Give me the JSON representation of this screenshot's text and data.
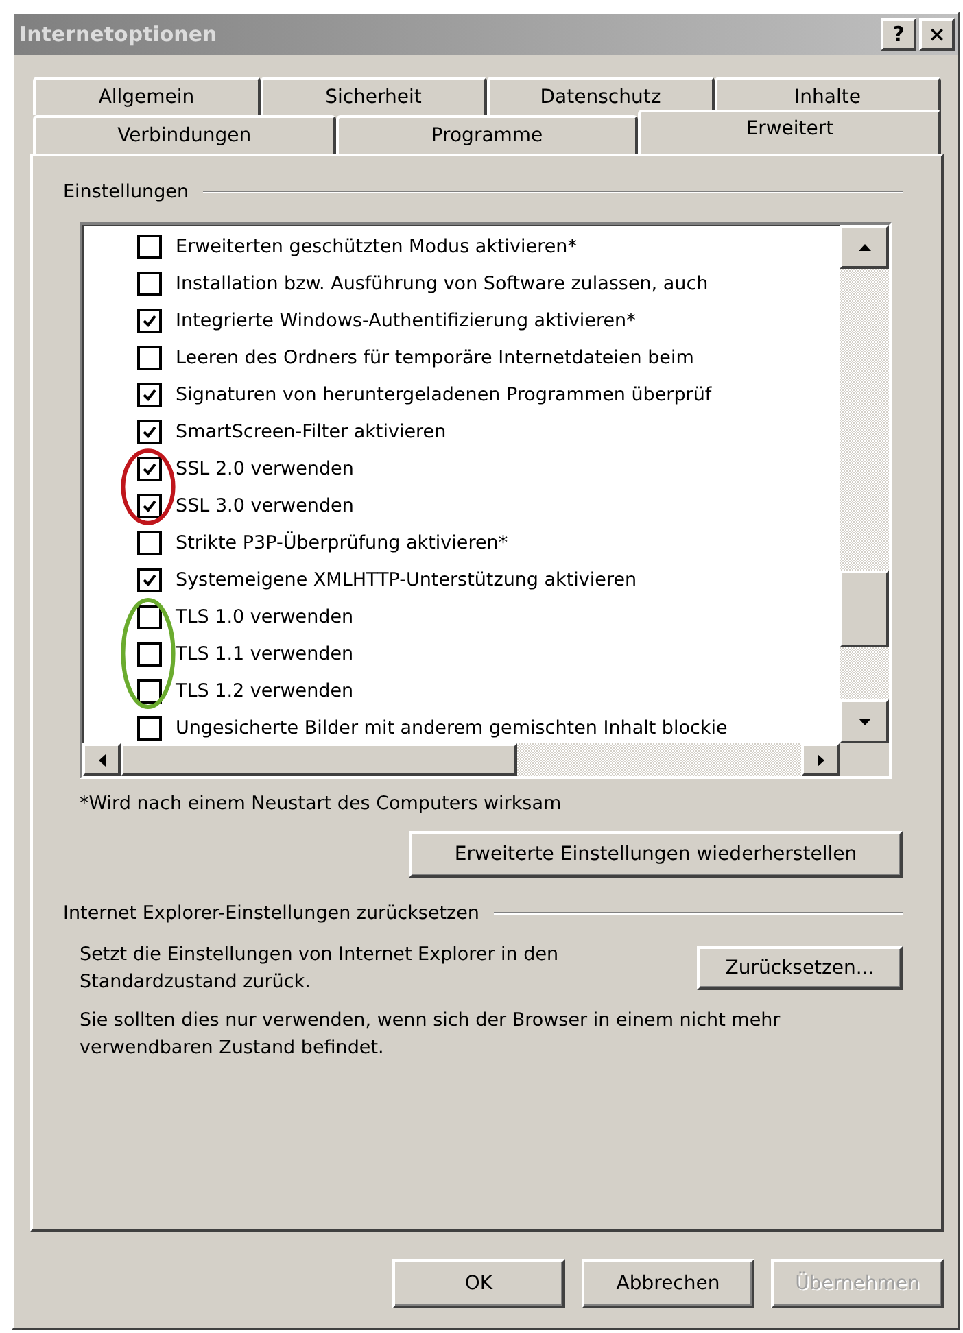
{
  "window": {
    "title": "Internetoptionen",
    "help_button": "?",
    "close_button": "×"
  },
  "tab_rows": [
    {
      "tabs": [
        {
          "label": "Allgemein",
          "selected": false
        },
        {
          "label": "Sicherheit",
          "selected": false
        },
        {
          "label": "Datenschutz",
          "selected": false
        },
        {
          "label": "Inhalte",
          "selected": false
        }
      ]
    },
    {
      "tabs": [
        {
          "label": "Verbindungen",
          "selected": false
        },
        {
          "label": "Programme",
          "selected": false
        },
        {
          "label": "Erweitert",
          "selected": true
        }
      ]
    }
  ],
  "settings": {
    "label": "Einstellungen",
    "items": [
      {
        "label": "Erweiterten geschützten Modus aktivieren*",
        "checked": false
      },
      {
        "label": "Installation bzw. Ausführung von Software zulassen, auch",
        "checked": false
      },
      {
        "label": "Integrierte Windows-Authentifizierung aktivieren*",
        "checked": true
      },
      {
        "label": "Leeren des Ordners für temporäre Internetdateien beim",
        "checked": false
      },
      {
        "label": "Signaturen von heruntergeladenen Programmen überprüf",
        "checked": true
      },
      {
        "label": "SmartScreen-Filter aktivieren",
        "checked": true
      },
      {
        "label": "SSL 2.0 verwenden",
        "checked": true,
        "color": "#c0161c"
      },
      {
        "label": "SSL 3.0 verwenden",
        "checked": true,
        "color": "#c0161c"
      },
      {
        "label": "Strikte P3P-Überprüfung aktivieren*",
        "checked": false
      },
      {
        "label": "Systemeigene XMLHTTP-Unterstützung aktivieren",
        "checked": true
      },
      {
        "label": "TLS 1.0 verwenden",
        "checked": false,
        "color": "#6aab2e"
      },
      {
        "label": "TLS 1.1 verwenden",
        "checked": false,
        "color": "#6aab2e"
      },
      {
        "label": "TLS 1.2 verwenden",
        "checked": false,
        "color": "#6aab2e"
      },
      {
        "label": "Ungesicherte Bilder mit anderem gemischten Inhalt blockie",
        "checked": false
      }
    ],
    "footnote": "*Wird nach einem Neustart des Computers wirksam",
    "restore_button": "Erweiterte Einstellungen wiederherstellen"
  },
  "reset": {
    "label": "Internet Explorer-Einstellungen zurücksetzen",
    "description": "Setzt die Einstellungen von Internet Explorer in den Standardzustand zurück.",
    "button": "Zurücksetzen...",
    "note": "Sie sollten dies nur verwenden, wenn sich der Browser in einem nicht mehr verwendbaren Zustand befindet."
  },
  "buttons": [
    {
      "label": "OK",
      "disabled": false
    },
    {
      "label": "Abbrechen",
      "disabled": false
    },
    {
      "label": "Übernehmen",
      "disabled": true
    }
  ]
}
